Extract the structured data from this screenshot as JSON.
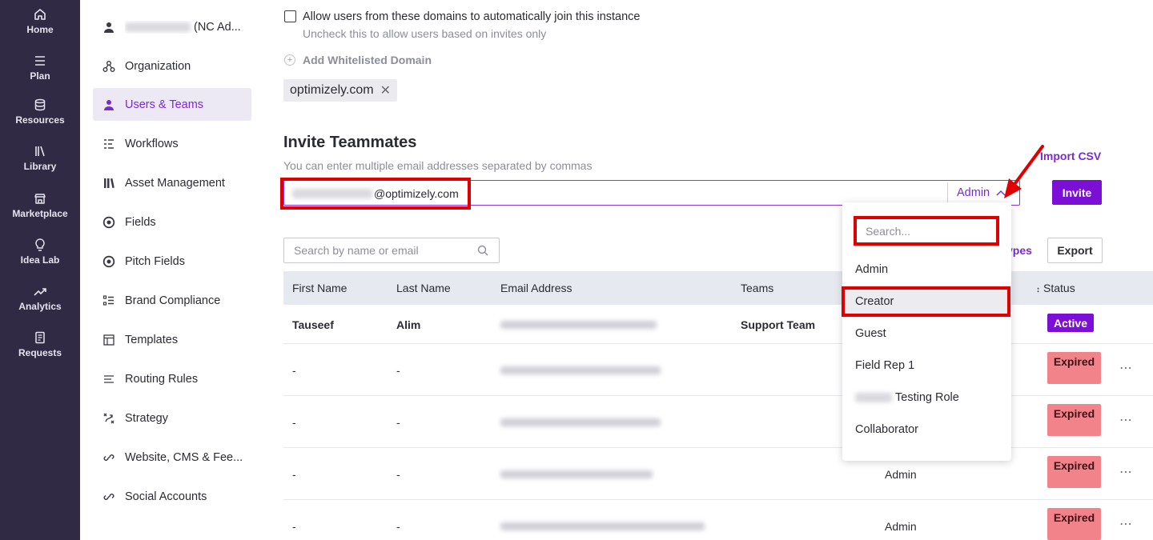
{
  "rail": [
    {
      "label": "Home",
      "icon": "home-icon"
    },
    {
      "label": "Plan",
      "icon": "list-icon"
    },
    {
      "label": "Resources",
      "icon": "database-icon"
    },
    {
      "label": "Library",
      "icon": "library-icon"
    },
    {
      "label": "Marketplace",
      "icon": "store-icon"
    },
    {
      "label": "Idea Lab",
      "icon": "lightbulb-icon"
    },
    {
      "label": "Analytics",
      "icon": "trend-icon"
    },
    {
      "label": "Requests",
      "icon": "document-icon"
    }
  ],
  "sidebar": {
    "profile_suffix": "(NC Ad...",
    "items": [
      {
        "label": "Organization",
        "icon": "organization-icon"
      },
      {
        "label": "Users & Teams",
        "icon": "user-icon",
        "active": true
      },
      {
        "label": "Workflows",
        "icon": "workflow-icon"
      },
      {
        "label": "Asset Management",
        "icon": "books-icon"
      },
      {
        "label": "Fields",
        "icon": "target-icon"
      },
      {
        "label": "Pitch Fields",
        "icon": "target-icon"
      },
      {
        "label": "Brand Compliance",
        "icon": "checklist-icon"
      },
      {
        "label": "Templates",
        "icon": "template-icon"
      },
      {
        "label": "Routing Rules",
        "icon": "routing-icon"
      },
      {
        "label": "Strategy",
        "icon": "strategy-icon"
      },
      {
        "label": "Website, CMS & Fee...",
        "icon": "link-icon"
      },
      {
        "label": "Social Accounts",
        "icon": "link-icon"
      }
    ]
  },
  "domains": {
    "allow_label": "Allow users from these domains to automatically join this instance",
    "allow_help": "Uncheck this to allow users based on invites only",
    "add_label": "Add Whitelisted Domain",
    "chip": "optimizely.com"
  },
  "invite": {
    "title": "Invite Teammates",
    "help": "You can enter multiple email addresses separated by commas",
    "import_csv": "Import CSV",
    "email_suffix": "@optimizely.com",
    "role": "Admin",
    "button": "Invite"
  },
  "table_tools": {
    "search_placeholder": "Search by name or email",
    "types_link": "ypes",
    "export": "Export"
  },
  "table": {
    "columns": [
      "First Name",
      "Last Name",
      "Email Address",
      "Teams",
      "Status"
    ],
    "rows": [
      {
        "first": "Tauseef",
        "last": "Alim",
        "team": "Support Team",
        "role": "",
        "status": "Active"
      },
      {
        "first": "-",
        "last": "-",
        "team": "",
        "role": "",
        "status": "Expired"
      },
      {
        "first": "-",
        "last": "-",
        "team": "",
        "role": "",
        "status": "Expired"
      },
      {
        "first": "-",
        "last": "-",
        "team": "",
        "role": "Admin",
        "status": "Expired"
      },
      {
        "first": "-",
        "last": "-",
        "team": "",
        "role": "Admin",
        "status": "Expired"
      }
    ]
  },
  "role_dropdown": {
    "search_placeholder": "Search...",
    "options": [
      "Admin",
      "Creator",
      "Guest",
      "Field Rep 1",
      "Testing Role",
      "Collaborator"
    ],
    "highlighted": "Creator"
  },
  "colors": {
    "rail_bg": "#302a45",
    "accent": "#7b0fd6",
    "expired": "#f3838a",
    "annotation": "#e00000"
  }
}
